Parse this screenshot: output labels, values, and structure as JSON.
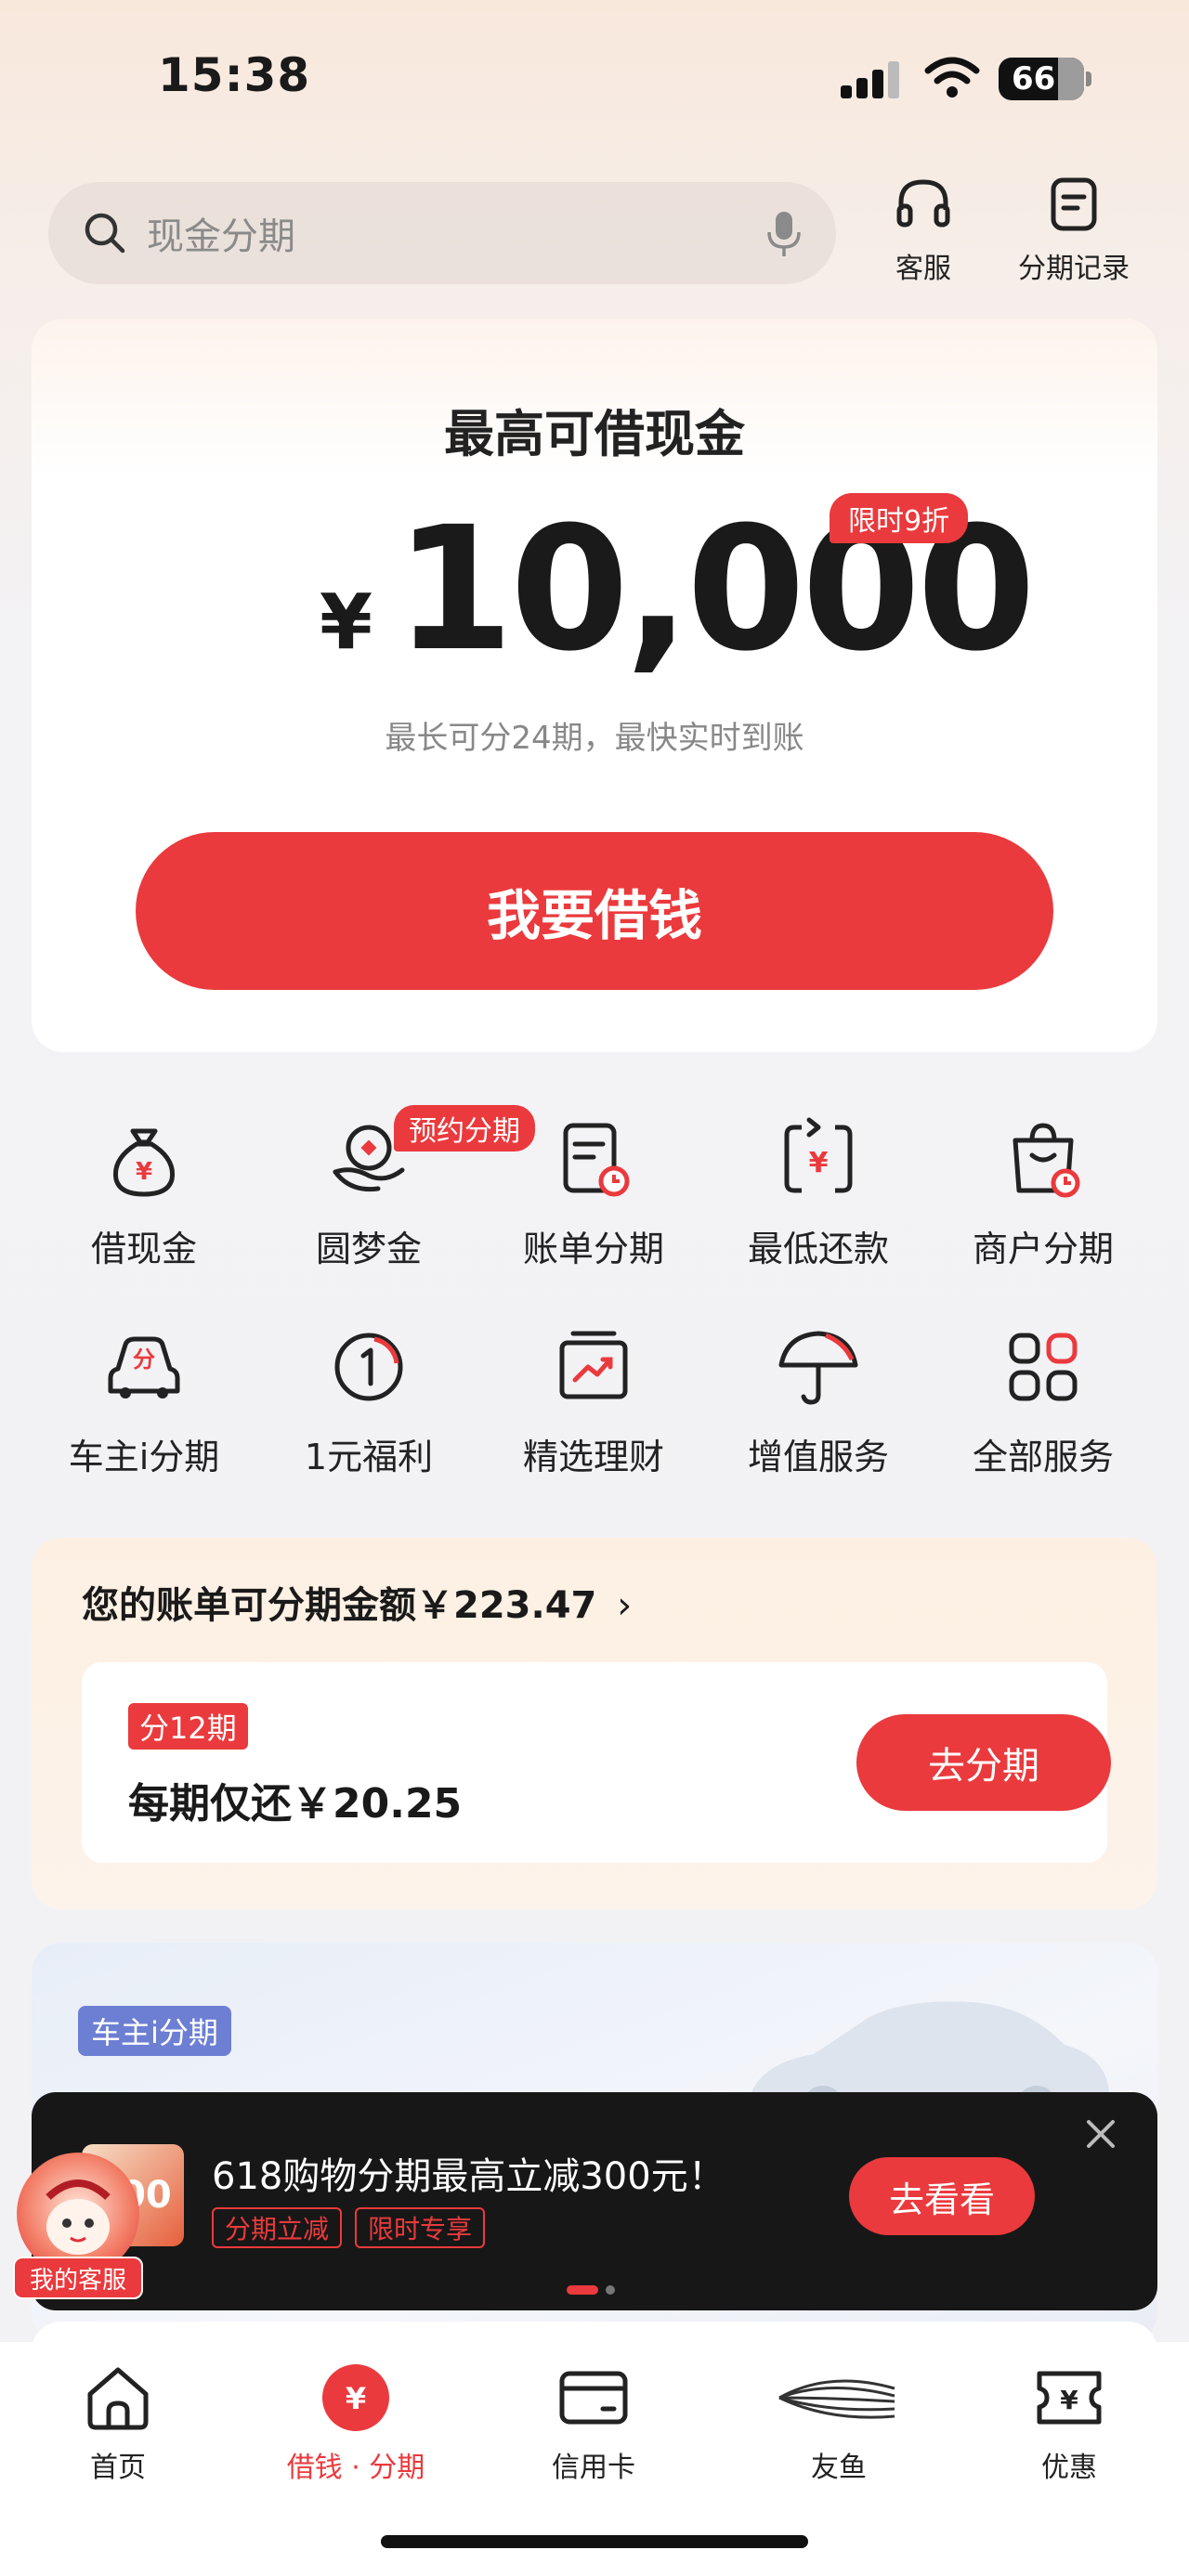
{
  "status_bar": {
    "time": "15:38",
    "battery": "66"
  },
  "search": {
    "placeholder": "现金分期"
  },
  "top_actions": {
    "service_label": "客服",
    "records_label": "分期记录"
  },
  "hero": {
    "title": "最高可借现金",
    "currency": "¥",
    "amount": "10,000",
    "badge": "限时9折",
    "subtitle": "最长可分24期，最快实时到账",
    "button": "我要借钱"
  },
  "services": {
    "items": [
      {
        "label": "借现金",
        "icon": "money-bag-icon"
      },
      {
        "label": "圆梦金",
        "icon": "hand-coin-icon",
        "badge": "预约分期"
      },
      {
        "label": "账单分期",
        "icon": "bill-clock-icon"
      },
      {
        "label": "最低还款",
        "icon": "repay-icon"
      },
      {
        "label": "商户分期",
        "icon": "shopping-bag-icon"
      },
      {
        "label": "车主i分期",
        "icon": "car-icon"
      },
      {
        "label": "1元福利",
        "icon": "one-yuan-icon"
      },
      {
        "label": "精选理财",
        "icon": "chart-trend-icon"
      },
      {
        "label": "增值服务",
        "icon": "umbrella-icon"
      },
      {
        "label": "全部服务",
        "icon": "grid-icon"
      }
    ]
  },
  "bill": {
    "title": "您的账单可分期金额￥223.47",
    "tag": "分12期",
    "per_period": "每期仅还￥20.25",
    "button": "去分期"
  },
  "promo": {
    "tag": "车主i分期"
  },
  "toast": {
    "thumb_text": "300",
    "title": "618购物分期最高立减300元！",
    "tags": [
      "分期立减",
      "限时专享"
    ],
    "button": "去看看"
  },
  "assistant": {
    "label": "我的客服"
  },
  "tab_bar": {
    "items": [
      {
        "label": "首页",
        "icon": "home-icon"
      },
      {
        "label": "借钱 · 分期",
        "icon": "yuan-circle-icon",
        "active": true
      },
      {
        "label": "信用卡",
        "icon": "credit-card-icon"
      },
      {
        "label": "友鱼",
        "icon": "fish-icon"
      },
      {
        "label": "优惠",
        "icon": "coupon-icon"
      }
    ]
  },
  "colors": {
    "accent": "#ea3a3d",
    "promo_tag": "#6d7fd3",
    "toast_bg": "#171717"
  }
}
